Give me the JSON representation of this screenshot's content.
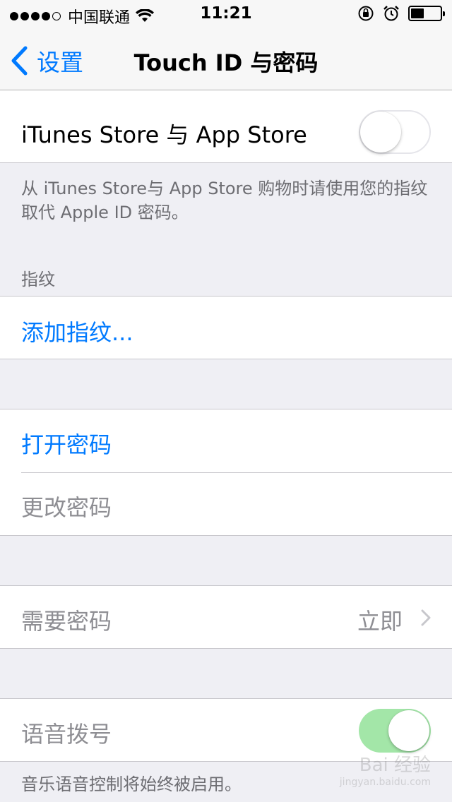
{
  "status_bar": {
    "signal_dots": 5,
    "signal_filled": 4,
    "carrier": "中国联通",
    "time": "11:21",
    "battery_level": 0.4,
    "icons": [
      "wifi-icon",
      "rotation-lock-icon",
      "alarm-icon",
      "battery-icon"
    ]
  },
  "nav": {
    "back_label": "设置",
    "title": "Touch ID 与密码"
  },
  "itunes_row": {
    "label": "iTunes Store 与 App Store",
    "toggle_on": false,
    "footer": "从 iTunes Store与 App Store 购物时请使用您的指纹取代 Apple ID 密码。"
  },
  "fingerprints": {
    "header": "指纹",
    "add_label": "添加指纹..."
  },
  "passcode": {
    "turn_on_label": "打开密码",
    "change_label": "更改密码"
  },
  "require_row": {
    "label": "需要密码",
    "value": "立即"
  },
  "voice_dial": {
    "label": "语音拨号",
    "toggle_on": true,
    "footer": "音乐语音控制将始终被启用。"
  },
  "watermark": {
    "text": "Bai 经验",
    "sub": "jingyan.baidu.com"
  },
  "colors": {
    "accent": "#007aff",
    "background": "#efeff4",
    "switch_on": "#a3e6a8"
  }
}
